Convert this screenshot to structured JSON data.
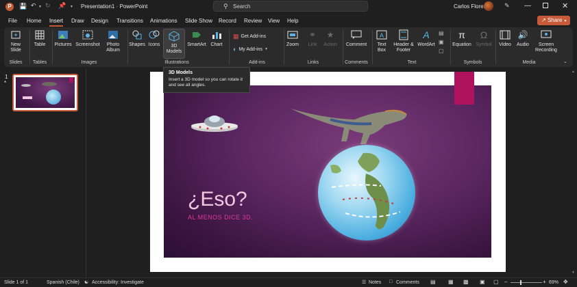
{
  "window": {
    "title": "Presentation1 · PowerPoint",
    "search_placeholder": "Search",
    "user": "Carlos Flores"
  },
  "menu": {
    "tabs": [
      "File",
      "Home",
      "Insert",
      "Draw",
      "Design",
      "Transitions",
      "Animations",
      "Slide Show",
      "Record",
      "Review",
      "View",
      "Help"
    ],
    "active": "Insert",
    "share": "Share"
  },
  "ribbon": {
    "groups": [
      "Slides",
      "Tables",
      "Images",
      "Illustrations",
      "Add-ins",
      "Links",
      "Comments",
      "Text",
      "Symbols",
      "Media"
    ],
    "buttons": {
      "new_slide": "New Slide",
      "table": "Table",
      "pictures": "Pictures",
      "screenshot": "Screenshot",
      "photo_album": "Photo Album",
      "shapes": "Shapes",
      "icons": "Icons",
      "models_3d": "3D Models",
      "smartart": "SmartArt",
      "chart": "Chart",
      "get_addins": "Get Add-ins",
      "my_addins": "My Add-ins",
      "zoom": "Zoom",
      "link": "Link",
      "action": "Action",
      "comment": "Comment",
      "text_box": "Text Box",
      "header_footer": "Header & Footer",
      "wordart": "WordArt",
      "equation": "Equation",
      "symbol": "Symbol",
      "video": "Video",
      "audio": "Audio",
      "screen_recording": "Screen Recording"
    }
  },
  "tooltip": {
    "title": "3D Models",
    "body": "Insert a 3D model so you can rotate it and see all angles."
  },
  "thumbnail": {
    "number": "1",
    "mark": "*"
  },
  "slide": {
    "title": "¿Eso?",
    "subtitle": "AL MENOS DICE 3D."
  },
  "status": {
    "slide_info": "Slide 1 of 1",
    "language": "Spanish (Chile)",
    "accessibility": "Accessibility: Investigate",
    "notes": "Notes",
    "comments": "Comments",
    "zoom": "69%",
    "zoom_fraction": 0.69
  },
  "colors": {
    "accent": "#c75b39",
    "share_bg": "#c75b39",
    "slide_tab": "#b0135e",
    "title_text": "#f4c7e0",
    "subtitle_text": "#e0389a"
  }
}
